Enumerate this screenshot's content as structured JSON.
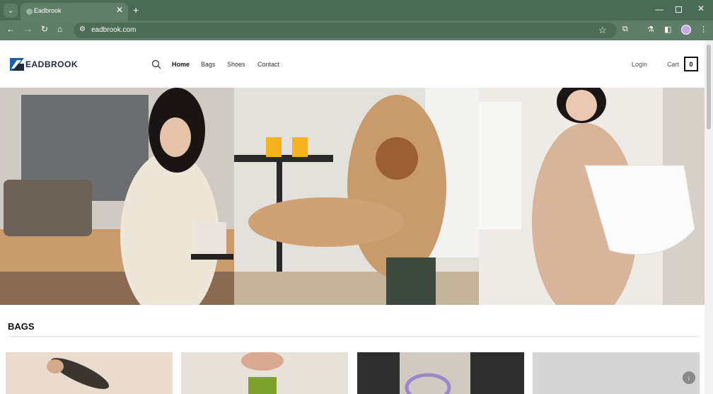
{
  "browser": {
    "tab_title": "Eadbrook",
    "url": "eadbrook.com",
    "icons": [
      "tab-search-icon",
      "close-icon",
      "plus-icon",
      "minimize-icon",
      "maximize-icon",
      "back-icon",
      "forward-icon",
      "reload-icon",
      "home-icon",
      "site-info-icon",
      "star-icon",
      "extensions-icon",
      "labs-icon",
      "sidebar-icon",
      "profile-icon",
      "menu-icon"
    ]
  },
  "site": {
    "logo_text": "EADBROOK",
    "nav": [
      "Home",
      "Bags",
      "Shoes",
      "Contact"
    ],
    "login_label": "Login",
    "cart_label": "Cart",
    "cart_count": "0",
    "section_title": "BAGS",
    "colors": {
      "brand_blue": "#1f5fa8",
      "chrome_green": "#4a6b54"
    }
  }
}
